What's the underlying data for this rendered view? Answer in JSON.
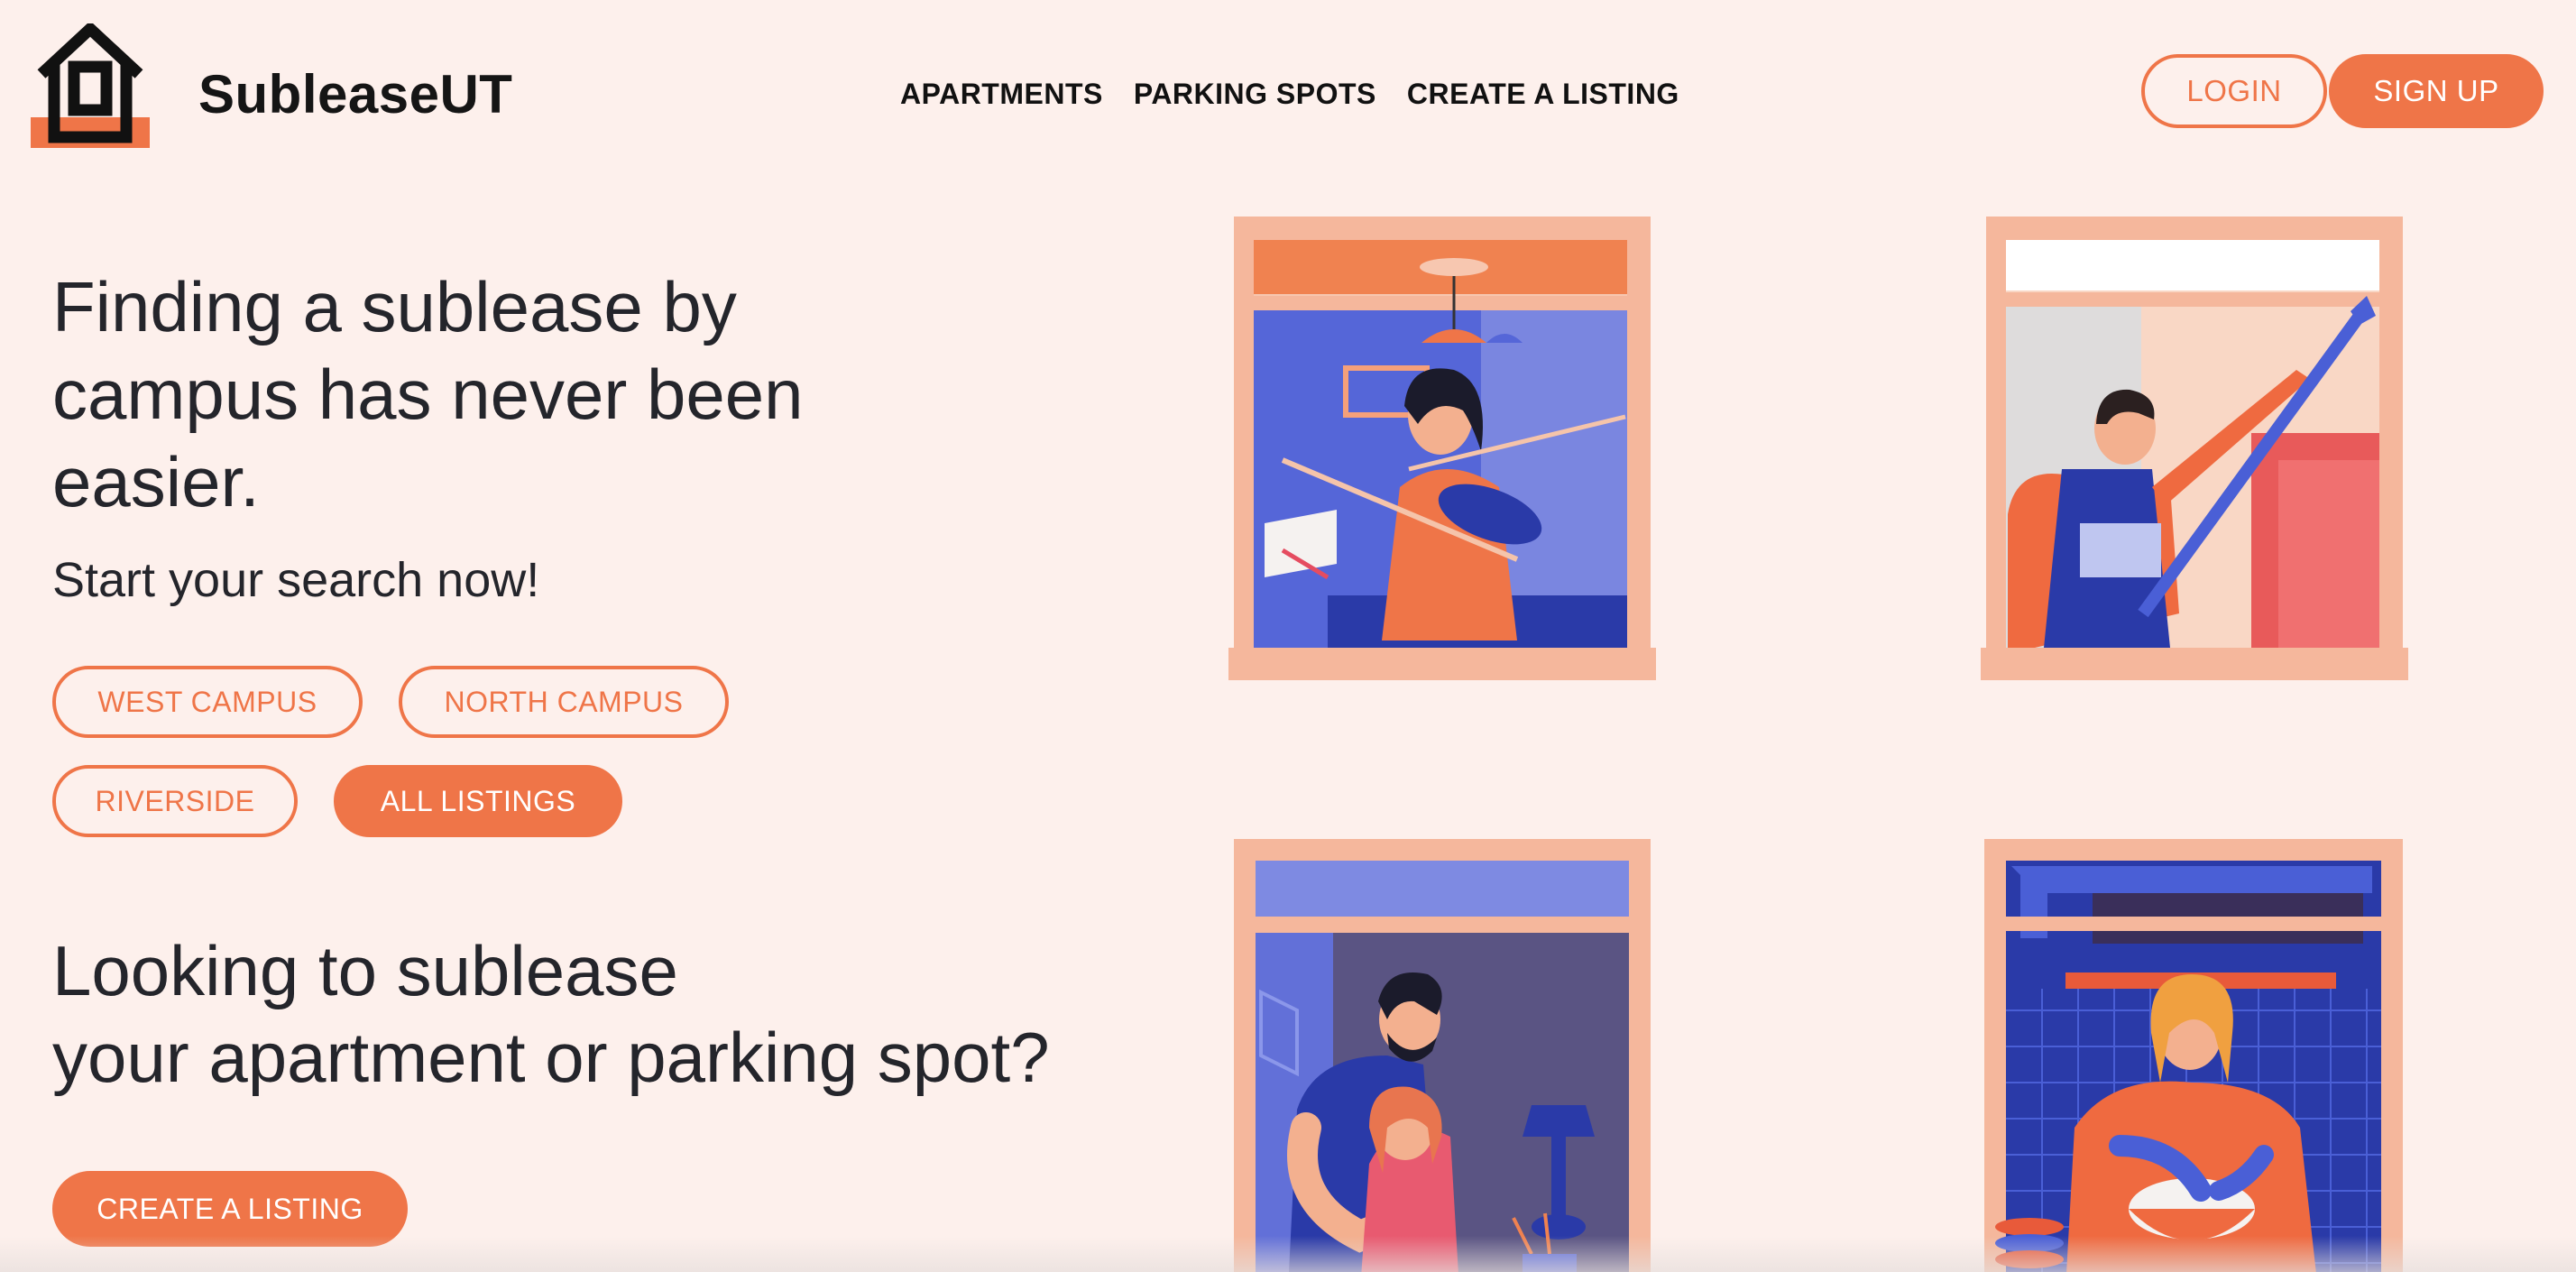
{
  "brand": {
    "name": "SubleaseUT"
  },
  "nav": {
    "items": [
      "APARTMENTS",
      "PARKING SPOTS",
      "CREATE A LISTING"
    ]
  },
  "auth": {
    "login": "LOGIN",
    "signup": "SIGN UP"
  },
  "hero": {
    "title": "Finding a sublease by campus has never been easier.",
    "subtitle": "Start your search now!",
    "campuses": [
      "WEST CAMPUS",
      "NORTH CAMPUS",
      "RIVERSIDE",
      "ALL LISTINGS"
    ]
  },
  "lease": {
    "title_line1": "Looking to sublease",
    "title_line2": "your apartment or parking spot?",
    "cta": "CREATE A LISTING"
  },
  "illustrations": [
    "violinist-window",
    "painter-window",
    "couple-window",
    "cook-window"
  ],
  "colors": {
    "accent": "#ef7548",
    "background": "#fdf0ec",
    "text": "#24252b",
    "frame": "#f5b79c",
    "blue": "#4a5fd6"
  }
}
